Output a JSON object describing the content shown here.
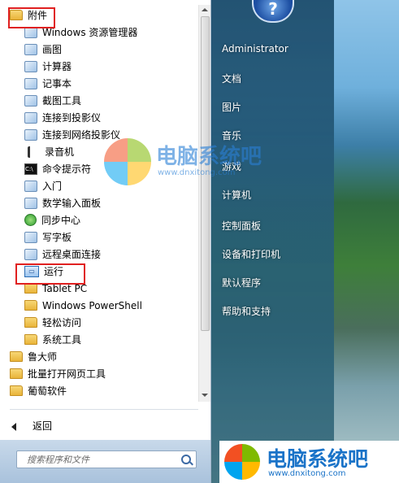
{
  "start_menu": {
    "programs": [
      {
        "label": "附件",
        "icon": "folder-icon",
        "level": 0
      },
      {
        "label": "Windows 资源管理器",
        "icon": "explorer-icon",
        "level": 1
      },
      {
        "label": "画图",
        "icon": "paint-icon",
        "level": 1
      },
      {
        "label": "计算器",
        "icon": "calculator-icon",
        "level": 1
      },
      {
        "label": "记事本",
        "icon": "notepad-icon",
        "level": 1
      },
      {
        "label": "截图工具",
        "icon": "snipping-icon",
        "level": 1
      },
      {
        "label": "连接到投影仪",
        "icon": "projector-icon",
        "level": 1
      },
      {
        "label": "连接到网络投影仪",
        "icon": "network-projector-icon",
        "level": 1
      },
      {
        "label": "录音机",
        "icon": "microphone-icon",
        "level": 1
      },
      {
        "label": "命令提示符",
        "icon": "cmd-icon",
        "level": 1
      },
      {
        "label": "入门",
        "icon": "getting-started-icon",
        "level": 1
      },
      {
        "label": "数学输入面板",
        "icon": "math-input-icon",
        "level": 1
      },
      {
        "label": "同步中心",
        "icon": "sync-icon",
        "level": 1
      },
      {
        "label": "写字板",
        "icon": "wordpad-icon",
        "level": 1
      },
      {
        "label": "远程桌面连接",
        "icon": "remote-desktop-icon",
        "level": 1
      },
      {
        "label": "运行",
        "icon": "run-icon",
        "level": 1
      },
      {
        "label": "Tablet PC",
        "icon": "folder-icon",
        "level": 1
      },
      {
        "label": "Windows PowerShell",
        "icon": "folder-icon",
        "level": 1
      },
      {
        "label": "轻松访问",
        "icon": "folder-icon",
        "level": 1
      },
      {
        "label": "系统工具",
        "icon": "folder-icon",
        "level": 1
      },
      {
        "label": "鲁大师",
        "icon": "folder-icon",
        "level": 0
      },
      {
        "label": "批量打开网页工具",
        "icon": "folder-icon",
        "level": 0
      },
      {
        "label": "葡萄软件",
        "icon": "folder-icon",
        "level": 0
      }
    ],
    "back_label": "返回",
    "search_placeholder": "搜索程序和文件",
    "help_badge": "?",
    "right_items": [
      "Administrator",
      "文档",
      "图片",
      "音乐",
      "游戏",
      "计算机",
      "控制面板",
      "设备和打印机",
      "默认程序",
      "帮助和支持"
    ]
  },
  "watermark": {
    "text": "电脑系统吧",
    "url": "www.dnxitong.com"
  },
  "colors": {
    "highlight_frame": "#e02020",
    "accent": "#2a7fd6"
  }
}
